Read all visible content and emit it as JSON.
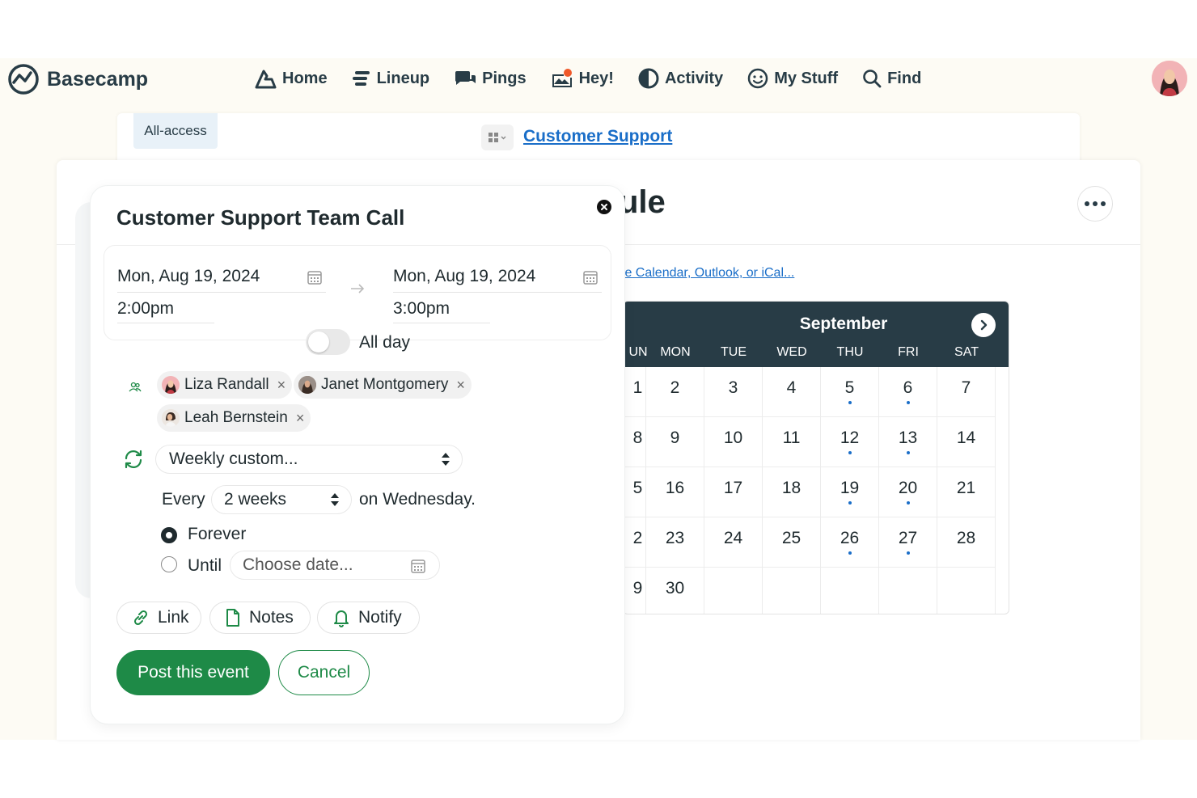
{
  "app": {
    "name": "Basecamp"
  },
  "nav": {
    "items": [
      {
        "label": "Home",
        "icon": "home-icon"
      },
      {
        "label": "Lineup",
        "icon": "lineup-icon"
      },
      {
        "label": "Pings",
        "icon": "pings-icon"
      },
      {
        "label": "Hey!",
        "icon": "hey-icon"
      },
      {
        "label": "Activity",
        "icon": "activity-icon"
      },
      {
        "label": "My Stuff",
        "icon": "my-stuff-icon"
      },
      {
        "label": "Find",
        "icon": "search-icon"
      }
    ]
  },
  "breadcrumb": {
    "badge": "All-access",
    "project": "Customer Support"
  },
  "page": {
    "title_fragment": "ule",
    "subscribe_link": "gle Calendar, Outlook, or iCal..."
  },
  "calendar": {
    "month": "September",
    "weekdays": [
      "UN",
      "MON",
      "TUE",
      "WED",
      "THU",
      "FRI",
      "SAT"
    ],
    "weeks": [
      [
        "1",
        "2",
        "3",
        "4",
        "5",
        "6",
        "7"
      ],
      [
        "8",
        "9",
        "10",
        "11",
        "12",
        "13",
        "14"
      ],
      [
        "5",
        "16",
        "17",
        "18",
        "19",
        "20",
        "21"
      ],
      [
        "2",
        "23",
        "24",
        "25",
        "26",
        "27",
        "28"
      ],
      [
        "9",
        "30",
        "",
        "",
        "",
        "",
        ""
      ]
    ],
    "event_days": [
      "5",
      "6",
      "12",
      "13",
      "19",
      "20",
      "26",
      "27"
    ],
    "event_dot_color": "#1a6ec8"
  },
  "event_form": {
    "title": "Customer Support Team Call",
    "start_date": "Mon, Aug 19, 2024",
    "start_time": "2:00pm",
    "end_date": "Mon, Aug 19, 2024",
    "end_time": "3:00pm",
    "all_day_label": "All day",
    "all_day": false,
    "attendees": [
      {
        "name": "Liza Randall"
      },
      {
        "name": "Janet Montgomery"
      },
      {
        "name": "Leah Bernstein"
      }
    ],
    "repeat": "Weekly custom...",
    "every_label": "Every",
    "interval": "2 weeks",
    "on_day": "on Wednesday.",
    "end_options": [
      {
        "label": "Forever",
        "selected": true
      },
      {
        "label": "Until",
        "selected": false
      }
    ],
    "until_placeholder": "Choose date...",
    "extras": [
      {
        "label": "Link",
        "icon": "link-icon"
      },
      {
        "label": "Notes",
        "icon": "notes-icon"
      },
      {
        "label": "Notify",
        "icon": "bell-icon"
      }
    ],
    "submit": "Post this event",
    "cancel": "Cancel"
  },
  "colors": {
    "accent_green": "#1e8a47",
    "dark": "#283c46",
    "link_blue": "#1a6ec8"
  }
}
